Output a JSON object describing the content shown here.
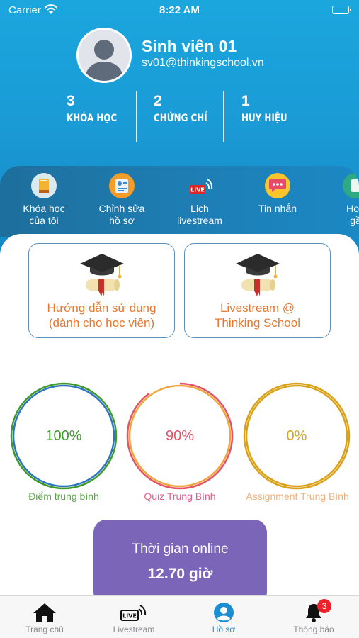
{
  "status_bar": {
    "carrier": "Carrier",
    "time": "8:22 AM"
  },
  "profile": {
    "name": "Sinh viên 01",
    "email": "sv01@thinkingschool.vn"
  },
  "stats": [
    {
      "value": "3",
      "label": "KHÓA HỌC"
    },
    {
      "value": "2",
      "label": "CHỨNG CHỈ"
    },
    {
      "value": "1",
      "label": "HUY HIỆU"
    }
  ],
  "shortcuts": [
    {
      "line1": "Khóa học",
      "line2": "của tôi",
      "icon": "book-icon"
    },
    {
      "line1": "Chỉnh sửa",
      "line2": "hồ sơ",
      "icon": "profile-edit-icon"
    },
    {
      "line1": "Lịch",
      "line2": "livestream",
      "icon": "live-icon"
    },
    {
      "line1": "Tin nhắn",
      "line2": "",
      "icon": "chat-icon"
    },
    {
      "line1": "Hoạ",
      "line2": "gầ",
      "icon": "activity-icon"
    }
  ],
  "guides": [
    {
      "line1": "Hướng dẫn sử dụng",
      "line2": "(dành cho học viên)",
      "icon": "graduation-icon"
    },
    {
      "line1": "Livestream @",
      "line2": "Thinking School",
      "icon": "graduation-icon"
    }
  ],
  "scores": [
    {
      "value": "100%",
      "label": "Điểm trung bình",
      "percent": 100,
      "color": "#3f9a2c",
      "inner_color": "#2d74c4"
    },
    {
      "value": "90%",
      "label": "Quiz Trung Bình",
      "percent": 90,
      "color": "#e25466",
      "inner_color": "#f1a53a"
    },
    {
      "value": "0%",
      "label": "Assignment Trung Bình",
      "percent": 0,
      "color": "#d9a21a",
      "inner_color": "#d9a21a"
    }
  ],
  "online": {
    "title": "Thời gian online",
    "value": "12.70 giờ"
  },
  "tabs": [
    {
      "label": "Trang chủ",
      "icon": "home-icon"
    },
    {
      "label": "Livestream",
      "icon": "livestream-icon"
    },
    {
      "label": "Hồ sơ",
      "icon": "profile-icon"
    },
    {
      "label": "Thông báo",
      "icon": "bell-icon",
      "badge": "3"
    }
  ],
  "colors": {
    "header": "#1ba6de",
    "accent_orange": "#e8772e",
    "online_card": "#7a65b9",
    "active_tab": "#1a8fd4"
  }
}
